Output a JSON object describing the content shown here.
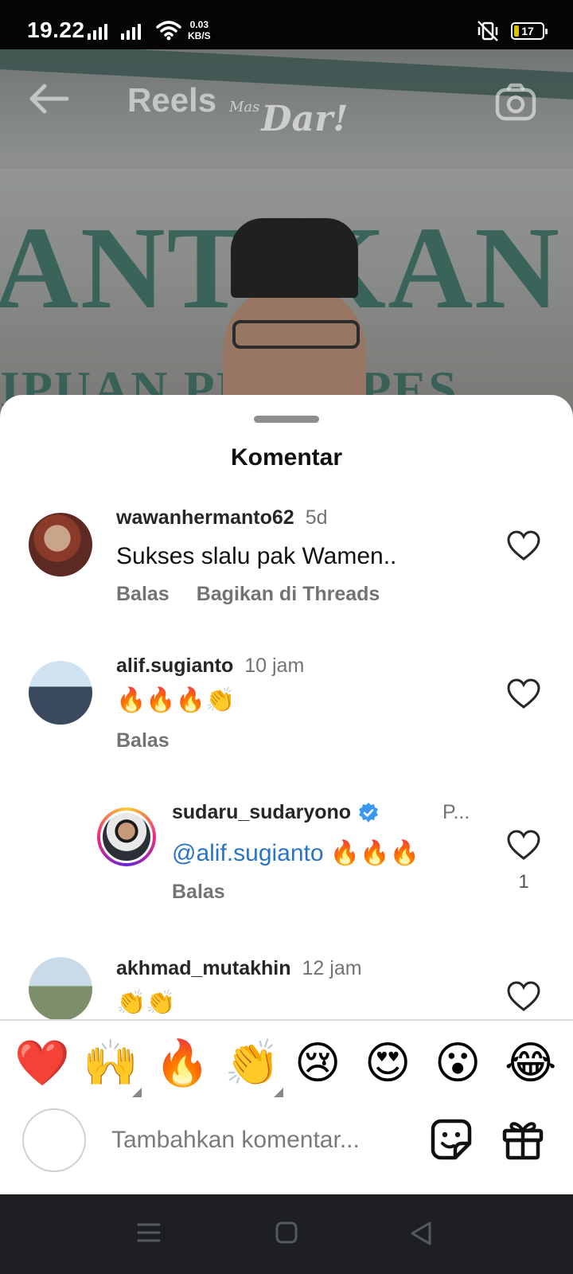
{
  "status_bar": {
    "time": "19.22",
    "net_speed_value": "0.03",
    "net_speed_unit": "KB/S",
    "battery": "17",
    "battery_level": 0.17
  },
  "reel": {
    "title": "Reels",
    "watermark_small": "Mas",
    "watermark_main": "Dar!",
    "banner_text_1": "ANTIKAN",
    "banner_text_2": "IPUAN PE   UH PES"
  },
  "sheet": {
    "title": "Komentar"
  },
  "comments": [
    {
      "username": "wawanhermanto62",
      "time": "5d",
      "text": "Sukses slalu pak Wamen..",
      "reply_label": "Balas",
      "share_label": "Bagikan di Threads"
    },
    {
      "username": "alif.sugianto",
      "time": "10 jam",
      "text": "🔥🔥🔥👏",
      "reply_label": "Balas"
    },
    {
      "username": "sudaru_sudaryono",
      "time": "P...",
      "mention": "@alif.sugianto",
      "text": " 🔥🔥🔥",
      "reply_label": "Balas",
      "like_count": "1",
      "verified": true
    },
    {
      "username": "akhmad_mutakhin",
      "time": "12 jam",
      "text": "👏👏"
    }
  ],
  "emoji_bar": [
    "❤️",
    "🙌",
    "🔥",
    "👏",
    "😢",
    "😍",
    "😮",
    "😂"
  ],
  "input": {
    "placeholder": "Tambahkan komentar..."
  },
  "colors": {
    "mention": "#2a74c7",
    "verified": "#3897f0",
    "heart": "#e0212e"
  }
}
